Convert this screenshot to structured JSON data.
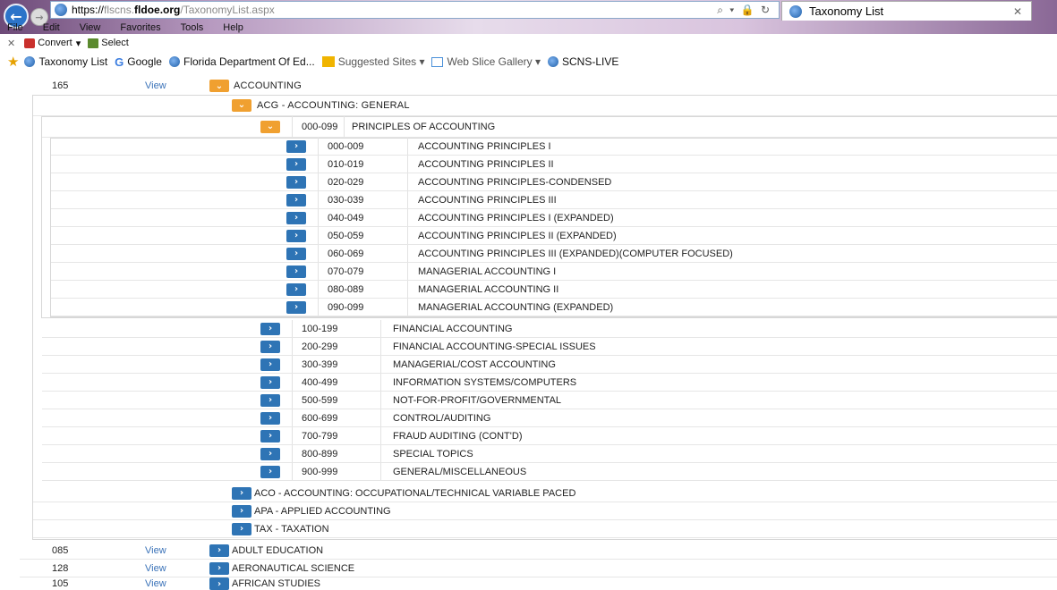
{
  "browser": {
    "url_scheme": "https://",
    "url_prefix": "flscns.",
    "url_host": "fldoe.org",
    "url_path": "/TaxonomyList.aspx",
    "address_tools": "⌕ ▾ 🔒 ↻",
    "tab_title": "Taxonomy List",
    "tab_close": "✕",
    "back_icon": "←",
    "forward_icon": "→"
  },
  "menu": [
    "File",
    "Edit",
    "View",
    "Favorites",
    "Tools",
    "Help"
  ],
  "commandbar": {
    "close": "✕",
    "convert": "Convert",
    "convert_arrow": "▾",
    "select": "Select"
  },
  "favorites": {
    "items": [
      {
        "label": "Taxonomy List",
        "icon": "ie-icon"
      },
      {
        "label": "Google",
        "icon": "google-icon"
      },
      {
        "label": "Florida Department Of Ed...",
        "icon": "ie-icon"
      },
      {
        "label": "Suggested Sites ▾",
        "icon": "suggested-sites-icon"
      },
      {
        "label": "Web Slice Gallery ▾",
        "icon": "web-slice-icon"
      },
      {
        "label": "SCNS-LIVE",
        "icon": "ie-icon"
      }
    ]
  },
  "glyphs": {
    "expand": "›",
    "collapse": "⌄"
  },
  "tree": {
    "top_accounting": {
      "num": "165",
      "view": "View",
      "label": "ACCOUNTING"
    },
    "acg": {
      "label": "ACG - ACCOUNTING: GENERAL"
    },
    "principles": {
      "code": "000-099",
      "label": "PRINCIPLES OF ACCOUNTING"
    },
    "principles_children": [
      {
        "code": "000-009",
        "label": "ACCOUNTING PRINCIPLES I"
      },
      {
        "code": "010-019",
        "label": "ACCOUNTING PRINCIPLES II"
      },
      {
        "code": "020-029",
        "label": "ACCOUNTING PRINCIPLES-CONDENSED"
      },
      {
        "code": "030-039",
        "label": "ACCOUNTING PRINCIPLES III"
      },
      {
        "code": "040-049",
        "label": "ACCOUNTING PRINCIPLES I (EXPANDED)"
      },
      {
        "code": "050-059",
        "label": "ACCOUNTING PRINCIPLES II (EXPANDED)"
      },
      {
        "code": "060-069",
        "label": "ACCOUNTING PRINCIPLES III (EXPANDED)(COMPUTER FOCUSED)"
      },
      {
        "code": "070-079",
        "label": "MANAGERIAL ACCOUNTING I"
      },
      {
        "code": "080-089",
        "label": "MANAGERIAL ACCOUNTING II"
      },
      {
        "code": "090-099",
        "label": "MANAGERIAL ACCOUNTING (EXPANDED)"
      }
    ],
    "acg_children": [
      {
        "code": "100-199",
        "label": "FINANCIAL ACCOUNTING"
      },
      {
        "code": "200-299",
        "label": "FINANCIAL ACCOUNTING-SPECIAL ISSUES"
      },
      {
        "code": "300-399",
        "label": "MANAGERIAL/COST ACCOUNTING"
      },
      {
        "code": "400-499",
        "label": "INFORMATION SYSTEMS/COMPUTERS"
      },
      {
        "code": "500-599",
        "label": "NOT-FOR-PROFIT/GOVERNMENTAL"
      },
      {
        "code": "600-699",
        "label": "CONTROL/AUDITING"
      },
      {
        "code": "700-799",
        "label": "FRAUD AUDITING (CONT'D)"
      },
      {
        "code": "800-899",
        "label": "SPECIAL TOPICS"
      },
      {
        "code": "900-999",
        "label": "GENERAL/MISCELLANEOUS"
      }
    ],
    "prefixes": [
      {
        "label": "ACO - ACCOUNTING: OCCUPATIONAL/TECHNICAL VARIABLE PACED"
      },
      {
        "label": "APA - APPLIED ACCOUNTING"
      },
      {
        "label": "TAX - TAXATION"
      }
    ],
    "top_items": [
      {
        "num": "085",
        "view": "View",
        "label": "ADULT EDUCATION"
      },
      {
        "num": "128",
        "view": "View",
        "label": "AERONAUTICAL SCIENCE"
      },
      {
        "num": "105",
        "view": "View",
        "label": "AFRICAN STUDIES"
      }
    ]
  }
}
